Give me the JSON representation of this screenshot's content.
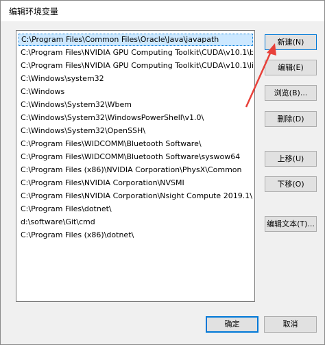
{
  "window": {
    "title": "编辑环境变量"
  },
  "paths": [
    "C:\\Program Files\\Common Files\\Oracle\\Java\\javapath",
    "C:\\Program Files\\NVIDIA GPU Computing Toolkit\\CUDA\\v10.1\\b...",
    "C:\\Program Files\\NVIDIA GPU Computing Toolkit\\CUDA\\v10.1\\li...",
    "C:\\Windows\\system32",
    "C:\\Windows",
    "C:\\Windows\\System32\\Wbem",
    "C:\\Windows\\System32\\WindowsPowerShell\\v1.0\\",
    "C:\\Windows\\System32\\OpenSSH\\",
    "C:\\Program Files\\WIDCOMM\\Bluetooth Software\\",
    "C:\\Program Files\\WIDCOMM\\Bluetooth Software\\syswow64",
    "C:\\Program Files (x86)\\NVIDIA Corporation\\PhysX\\Common",
    "C:\\Program Files\\NVIDIA Corporation\\NVSMI",
    "C:\\Program Files\\NVIDIA Corporation\\Nsight Compute 2019.1\\",
    "C:\\Program Files\\dotnet\\",
    "d:\\software\\Git\\cmd",
    "C:\\Program Files (x86)\\dotnet\\"
  ],
  "buttons": {
    "new": "新建(N)",
    "edit": "编辑(E)",
    "browse": "浏览(B)...",
    "delete": "删除(D)",
    "move_up": "上移(U)",
    "move_down": "下移(O)",
    "edit_text": "编辑文本(T)..."
  },
  "footer": {
    "ok": "确定",
    "cancel": "取消"
  },
  "accent_color": "#0078d7",
  "arrow_color": "#e8413a"
}
